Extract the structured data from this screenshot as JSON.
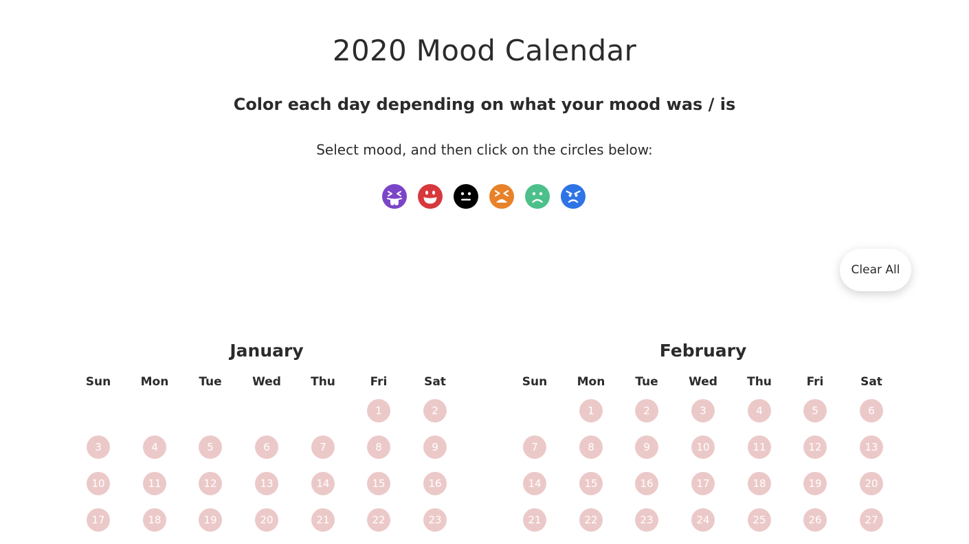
{
  "title": "2020 Mood Calendar",
  "subtitle": "Color each day depending on what your mood was / is",
  "instruction": "Select mood, and then click on the circles below:",
  "moods": [
    {
      "icon": "tongue-out-face-icon",
      "color": "#7b45c8"
    },
    {
      "icon": "grinning-face-icon",
      "color": "#d7383d"
    },
    {
      "icon": "neutral-face-icon",
      "color": "#000000"
    },
    {
      "icon": "tired-face-icon",
      "color": "#e8822a"
    },
    {
      "icon": "frowning-face-icon",
      "color": "#4cc08a"
    },
    {
      "icon": "angry-face-icon",
      "color": "#2e74e6"
    }
  ],
  "clear_button_label": "Clear All",
  "day_circle_color": "#ecc9c9",
  "weekdays": [
    "Sun",
    "Mon",
    "Tue",
    "Wed",
    "Thu",
    "Fri",
    "Sat"
  ],
  "months": [
    {
      "name": "January",
      "weeks": [
        [
          "",
          "",
          "",
          "",
          "",
          "1",
          "2"
        ],
        [
          "3",
          "4",
          "5",
          "6",
          "7",
          "8",
          "9"
        ],
        [
          "10",
          "11",
          "12",
          "13",
          "14",
          "15",
          "16"
        ],
        [
          "17",
          "18",
          "19",
          "20",
          "21",
          "22",
          "23"
        ]
      ]
    },
    {
      "name": "February",
      "weeks": [
        [
          "",
          "1",
          "2",
          "3",
          "4",
          "5",
          "6"
        ],
        [
          "7",
          "8",
          "9",
          "10",
          "11",
          "12",
          "13"
        ],
        [
          "14",
          "15",
          "16",
          "17",
          "18",
          "19",
          "20"
        ],
        [
          "21",
          "22",
          "23",
          "24",
          "25",
          "26",
          "27"
        ]
      ]
    }
  ]
}
